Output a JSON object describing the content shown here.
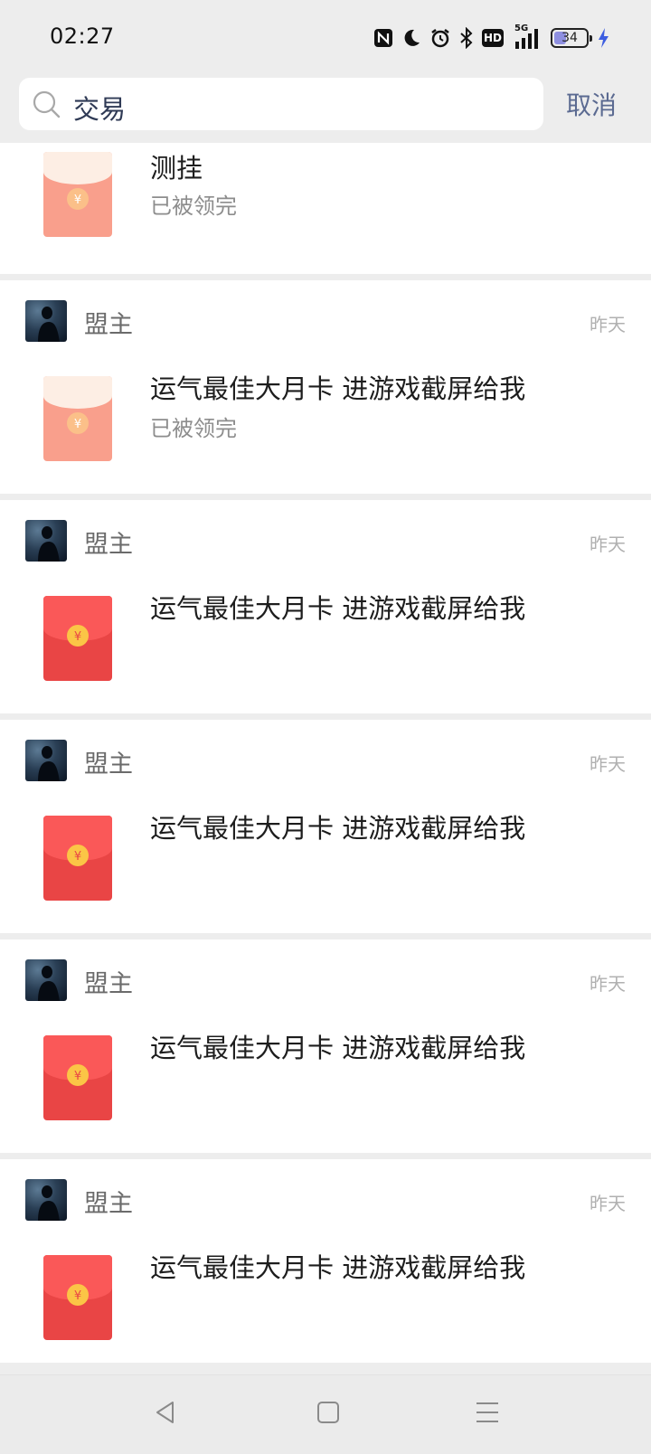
{
  "status_bar": {
    "time": "02:27",
    "battery_level": "34",
    "signal_label": "5G",
    "hd_label": "HD",
    "icons": [
      "nfc-icon",
      "moon-icon",
      "alarm-icon",
      "bluetooth-icon",
      "hd-icon",
      "signal-5g-icon",
      "battery-icon",
      "charging-icon"
    ]
  },
  "search": {
    "query": "交易",
    "cancel_label": "取消"
  },
  "results": [
    {
      "sender": "",
      "time": "",
      "text": "测挂",
      "status": "已被领完",
      "opened": true
    },
    {
      "sender": "盟主",
      "time": "昨天",
      "text": "运气最佳大月卡 进游戏截屏给我",
      "status": "已被领完",
      "opened": true
    },
    {
      "sender": "盟主",
      "time": "昨天",
      "text": "运气最佳大月卡 进游戏截屏给我",
      "status": "",
      "opened": false
    },
    {
      "sender": "盟主",
      "time": "昨天",
      "text": "运气最佳大月卡 进游戏截屏给我",
      "status": "",
      "opened": false
    },
    {
      "sender": "盟主",
      "time": "昨天",
      "text": "运气最佳大月卡 进游戏截屏给我",
      "status": "",
      "opened": false
    },
    {
      "sender": "盟主",
      "time": "昨天",
      "text": "运气最佳大月卡 进游戏截屏给我",
      "status": "",
      "opened": false
    }
  ],
  "colors": {
    "envelope_opened": "#f99f8c",
    "envelope_unopened": "#f04a4a",
    "coin": "#fbc546",
    "accent_text": "#5b6a91"
  },
  "nav": {
    "icons": [
      "back-icon",
      "home-icon",
      "recents-icon"
    ]
  }
}
